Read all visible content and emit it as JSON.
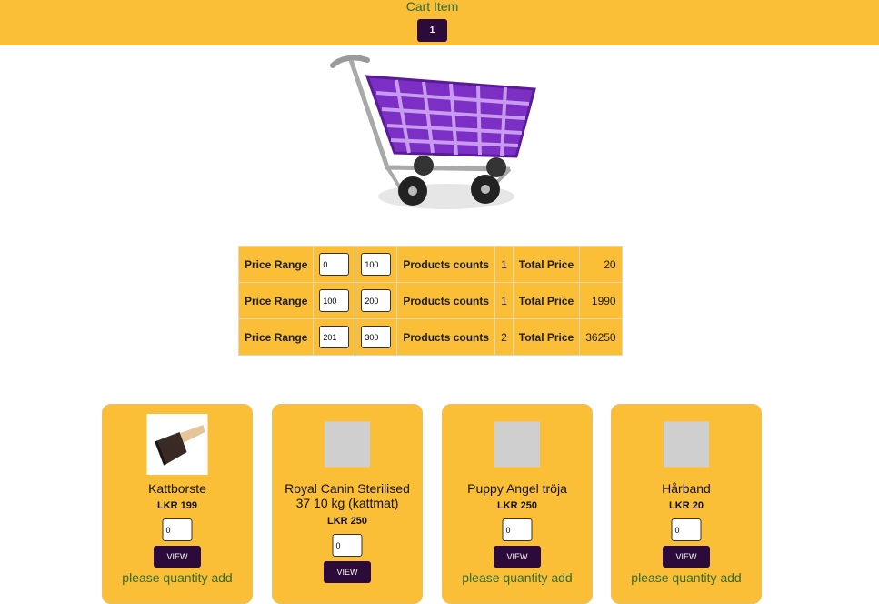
{
  "header": {
    "title": "Cart Item",
    "cart_count": "1"
  },
  "price_table": {
    "label_range": "Price Range",
    "label_counts": "Products counts",
    "label_total": "Total Price",
    "rows": [
      {
        "min": "0",
        "max": "100",
        "count": "1",
        "total": "20"
      },
      {
        "min": "100",
        "max": "200",
        "count": "1",
        "total": "1990"
      },
      {
        "min": "201",
        "max": "300",
        "count": "2",
        "total": "36250"
      }
    ]
  },
  "products": [
    {
      "name": "Kattborste",
      "price": "LKR 199",
      "qty": "0",
      "view_label": "VIEW",
      "message": "please quantity add",
      "image": "brush"
    },
    {
      "name": "Royal Canin Sterilised 37 10 kg (kattmat)",
      "price": "LKR 250",
      "qty": "0",
      "view_label": "VIEW",
      "message": "",
      "image": "placeholder"
    },
    {
      "name": "Puppy Angel tröja",
      "price": "LKR 250",
      "qty": "0",
      "view_label": "VIEW",
      "message": "please quantity add",
      "image": "placeholder"
    },
    {
      "name": "Hårband",
      "price": "LKR 20",
      "qty": "0",
      "view_label": "VIEW",
      "message": "please quantity add",
      "image": "placeholder"
    }
  ],
  "colors": {
    "accent": "#fbbf37",
    "button": "#2c0a3a",
    "message": "#2f6b2f",
    "cart": "#7b2fc4"
  }
}
